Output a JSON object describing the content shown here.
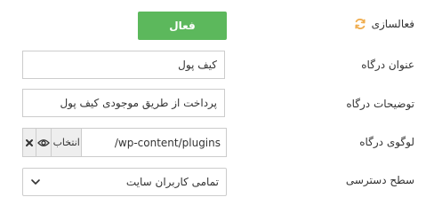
{
  "activation": {
    "label": "فعالسازی",
    "icon": "refresh-icon",
    "icon_color": "#f0ad4e",
    "button_label": "فعال",
    "button_color": "#5cb85c"
  },
  "gateway_title": {
    "label": "عنوان درگاه",
    "value": "کیف پول"
  },
  "gateway_description": {
    "label": "توضیحات درگاه",
    "value": "پرداخت از طریق موجودی کیف پول"
  },
  "gateway_logo": {
    "label": "لوگوی درگاه",
    "path_value": "/wp-content/plugins",
    "choose_label": "انتخاب",
    "view_icon": "eye-icon",
    "clear_icon": "close-icon"
  },
  "access_level": {
    "label": "سطح دسترسی",
    "selected": "تمامی کاربران سایت",
    "icon": "chevron-down-icon"
  }
}
